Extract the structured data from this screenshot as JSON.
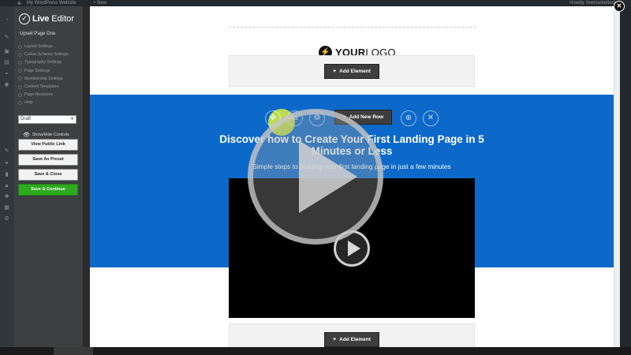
{
  "wp_bar": {
    "site_name": "My WordPress Website",
    "new_label": "+ New",
    "howdy": "Howdy, livemarkettest"
  },
  "sidebar": {
    "logo_text_bold": "Live",
    "logo_text_rest": "Editor",
    "page_name": "Upsell Page One",
    "menu_items": [
      "Layout Settings",
      "Colour Scheme Settings",
      "Typography Settings",
      "Page Settings",
      "Membership Settings",
      "Content Templates",
      "Page Revisions",
      "Help"
    ],
    "status_value": "Draft",
    "show_hide_label": "Show/Hide Controls",
    "buttons": {
      "view_public": "View Public Link",
      "save_preset": "Save As Preset",
      "save_close": "Save & Close",
      "save_continue": "Save & Continue"
    }
  },
  "canvas": {
    "logo_text_bold": "YOUR",
    "logo_text_rest": "LOGO",
    "add_element_label": "Add Element",
    "add_row_label": "Add New Row",
    "headline": "Discover how to Create Your First Landing Page in 5 Minutes or Less",
    "subheadline": "Simple steps to building your first landing page in just a few minutes"
  },
  "colors": {
    "accent_blue": "#0c69c9",
    "save_green": "#2eaa1f",
    "sidebar_bg": "#3d3f41"
  }
}
